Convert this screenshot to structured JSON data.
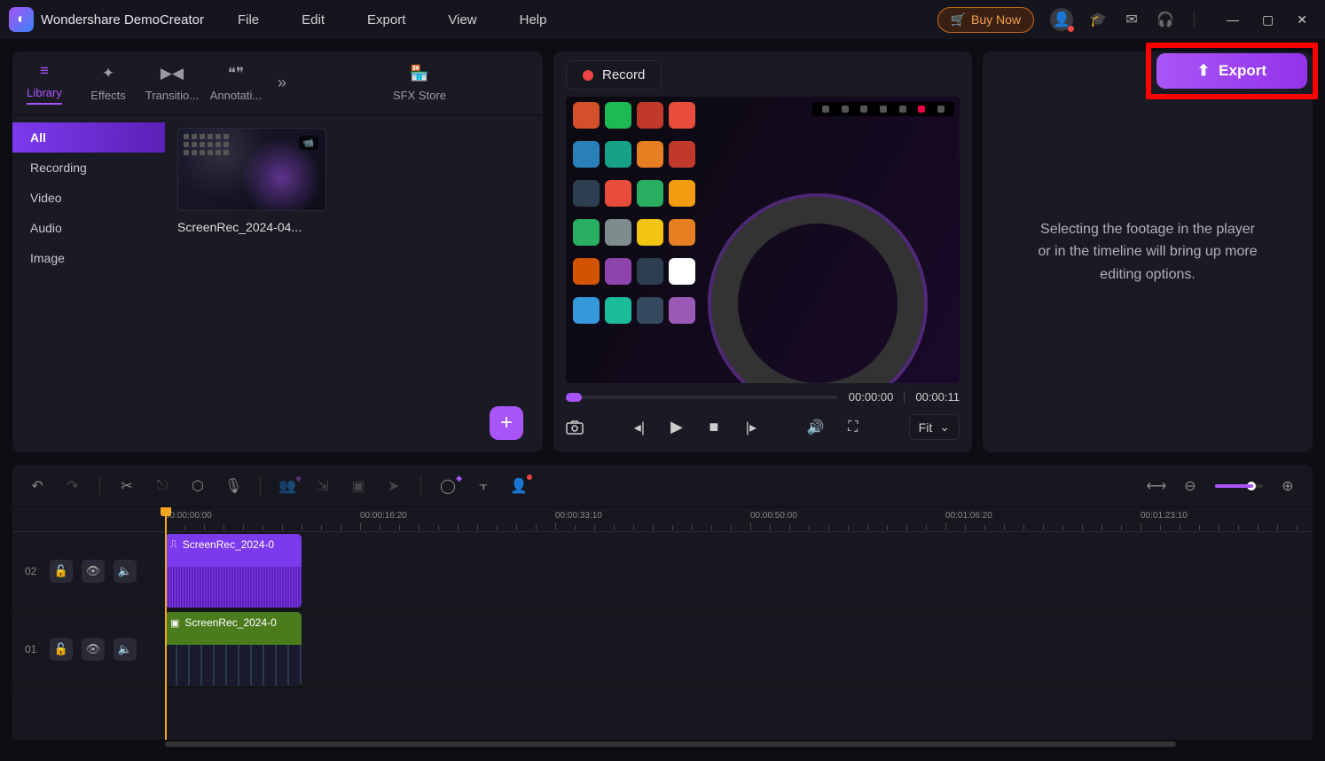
{
  "app": {
    "title": "Wondershare DemoCreator"
  },
  "menu": [
    "File",
    "Edit",
    "Export",
    "View",
    "Help"
  ],
  "titlebar": {
    "buy": "Buy Now"
  },
  "tabs": {
    "items": [
      {
        "label": "Library",
        "icon": "≡"
      },
      {
        "label": "Effects",
        "icon": "✦"
      },
      {
        "label": "Transitio...",
        "icon": "▶◀"
      },
      {
        "label": "Annotati...",
        "icon": "❝❞"
      }
    ],
    "sfx": {
      "label": "SFX Store",
      "icon": "🏪"
    }
  },
  "library": {
    "categories": [
      "All",
      "Recording",
      "Video",
      "Audio",
      "Image"
    ],
    "clips": [
      {
        "name": "ScreenRec_2024-04..."
      }
    ]
  },
  "record": {
    "label": "Record"
  },
  "preview": {
    "current": "00:00:00",
    "total": "00:00:11",
    "fit": "Fit"
  },
  "inspector": {
    "hint": "Selecting the footage in the player or in the timeline will bring up more editing options."
  },
  "export": {
    "label": "Export"
  },
  "ruler": [
    "00:00:00:00",
    "00:00:16:20",
    "00:00:33:10",
    "00:00:50:00",
    "00:01:06:20",
    "00:01:23:10"
  ],
  "tracks": [
    {
      "num": "02",
      "clip": "ScreenRec_2024-0",
      "type": "audio"
    },
    {
      "num": "01",
      "clip": "ScreenRec_2024-0",
      "type": "video"
    }
  ]
}
